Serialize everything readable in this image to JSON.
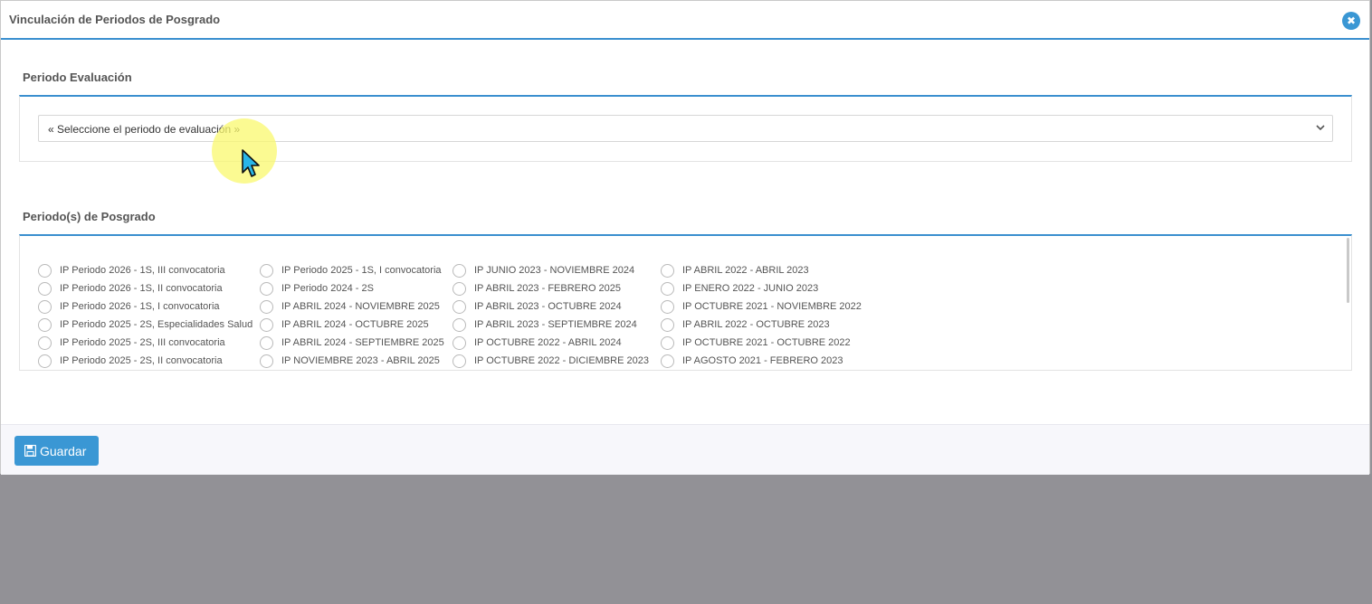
{
  "modal": {
    "title": "Vinculación de Periodos de Posgrado",
    "close_icon": "close-circle-icon"
  },
  "evaluation": {
    "section_title": "Periodo Evaluación",
    "select_value": "« Seleccione el periodo de evaluación »"
  },
  "postgrad": {
    "section_title": "Periodo(s) de Posgrado",
    "columns": [
      [
        "IP Periodo 2026 - 1S, III convocatoria",
        "IP Periodo 2026 - 1S, II convocatoria",
        "IP Periodo 2026 - 1S, I convocatoria",
        "IP Periodo 2025 - 2S, Especialidades Salud",
        "IP Periodo 2025 - 2S, III convocatoria",
        "IP Periodo 2025 - 2S, II convocatoria"
      ],
      [
        "IP Periodo 2025 - 1S, I convocatoria",
        "IP Periodo 2024 - 2S",
        "IP ABRIL 2024 - NOVIEMBRE 2025",
        "IP ABRIL 2024 - OCTUBRE 2025",
        "IP ABRIL 2024 - SEPTIEMBRE 2025",
        "IP NOVIEMBRE 2023 - ABRIL 2025"
      ],
      [
        "IP JUNIO 2023 - NOVIEMBRE 2024",
        "IP ABRIL 2023 - FEBRERO 2025",
        "IP ABRIL 2023 - OCTUBRE 2024",
        "IP ABRIL 2023 - SEPTIEMBRE 2024",
        "IP OCTUBRE 2022 - ABRIL 2024",
        "IP OCTUBRE 2022 - DICIEMBRE 2023"
      ],
      [
        "IP ABRIL 2022 - ABRIL 2023",
        "IP ENERO 2022 - JUNIO 2023",
        "IP OCTUBRE 2021 - NOVIEMBRE 2022",
        "IP ABRIL 2022 - OCTUBRE 2023",
        "IP OCTUBRE 2021 - OCTUBRE 2022",
        "IP AGOSTO 2021 - FEBRERO 2023"
      ]
    ]
  },
  "footer": {
    "save_label": "Guardar",
    "save_icon": "floppy-disk-icon"
  },
  "colors": {
    "accent": "#3a97d4",
    "overlay": "#929196"
  }
}
